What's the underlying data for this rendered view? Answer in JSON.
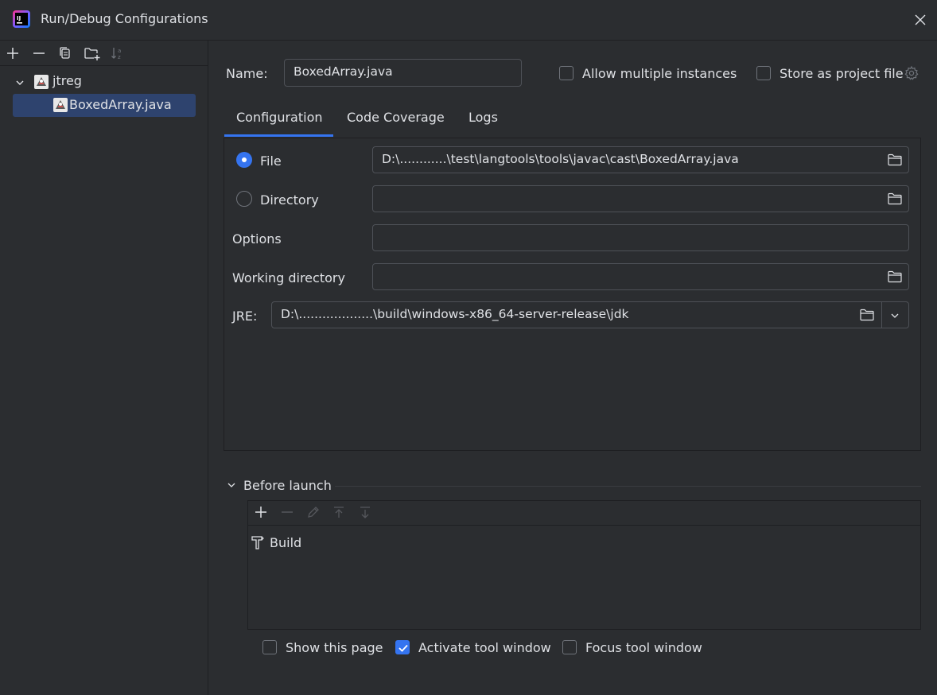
{
  "window": {
    "title": "Run/Debug Configurations",
    "icons": {
      "logo": "intellij-logo-icon",
      "close": "close-icon"
    }
  },
  "left": {
    "toolbar": [
      "add-icon",
      "remove-icon",
      "copy-icon",
      "new-folder-icon",
      "sort-icon"
    ],
    "tree": {
      "group": "jtreg",
      "item": "BoxedArray.java"
    }
  },
  "header": {
    "name_label": "Name:",
    "name_value": "BoxedArray.java",
    "allow_multiple_label": "Allow multiple instances",
    "store_project_label": "Store as project file",
    "allow_multiple_checked": false,
    "store_project_checked": false
  },
  "tabs": [
    {
      "label": "Configuration",
      "active": true
    },
    {
      "label": "Code Coverage",
      "active": false
    },
    {
      "label": "Logs",
      "active": false
    }
  ],
  "config": {
    "file_label": "File",
    "file_value": "D:\\............\\test\\langtools\\tools\\javac\\cast\\BoxedArray.java",
    "file_selected": true,
    "directory_label": "Directory",
    "directory_value": "",
    "options_label": "Options",
    "options_value": "",
    "workdir_label": "Working directory",
    "workdir_value": "",
    "jre_label": "JRE:",
    "jre_value": "D:\\...................\\build\\windows-x86_64-server-release\\jdk"
  },
  "before_launch": {
    "title": "Before launch",
    "toolbar": [
      "add-icon",
      "remove-icon",
      "edit-icon",
      "move-up-icon",
      "move-down-icon"
    ],
    "items": [
      "Build"
    ]
  },
  "footer": {
    "show_page_label": "Show this page",
    "show_page_checked": false,
    "activate_label": "Activate tool window",
    "activate_checked": true,
    "focus_label": "Focus tool window",
    "focus_checked": false
  },
  "colors": {
    "background": "#2b2d30",
    "accent": "#3574f0",
    "selection": "#2e436e",
    "text": "#dfe1e5",
    "border": "#4e5157"
  }
}
